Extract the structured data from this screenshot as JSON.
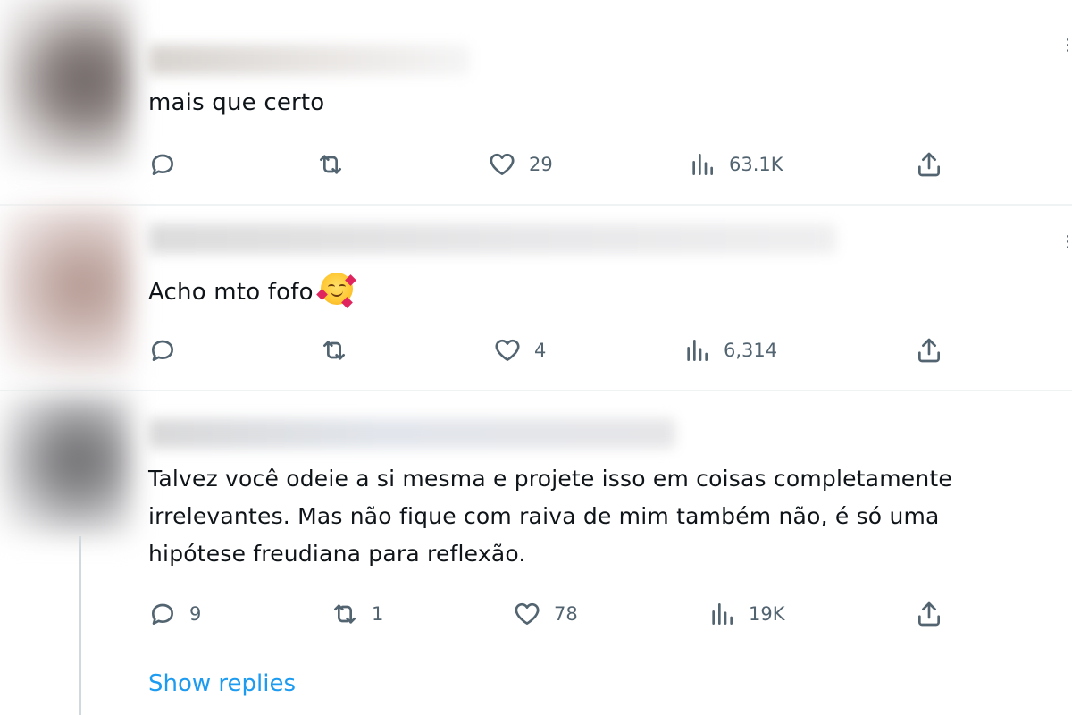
{
  "replies": [
    {
      "text": "mais que certo",
      "stats": {
        "replies": "",
        "retweets": "",
        "likes": "29",
        "views": "63.1K"
      }
    },
    {
      "text": "Acho mto fofo",
      "emoji": "smiling-face-with-hearts",
      "stats": {
        "replies": "",
        "retweets": "",
        "likes": "4",
        "views": "6,314"
      }
    },
    {
      "text_lines": [
        "Talvez você odeie a si mesma e projete isso em coisas completamente",
        "irrelevantes. Mas não fique com raiva de mim também não, é só uma",
        "hipótese freudiana para reflexão."
      ],
      "stats": {
        "replies": "9",
        "retweets": "1",
        "likes": "78",
        "views": "19K"
      }
    }
  ],
  "show_replies_label": "Show replies",
  "icons": {
    "reply": "reply-icon",
    "retweet": "retweet-icon",
    "like": "heart-icon",
    "views": "views-icon",
    "share": "share-icon"
  },
  "colors": {
    "link": "#1d9bf0",
    "muted": "#536471",
    "text": "#0f1419",
    "divider": "#eff3f4"
  }
}
